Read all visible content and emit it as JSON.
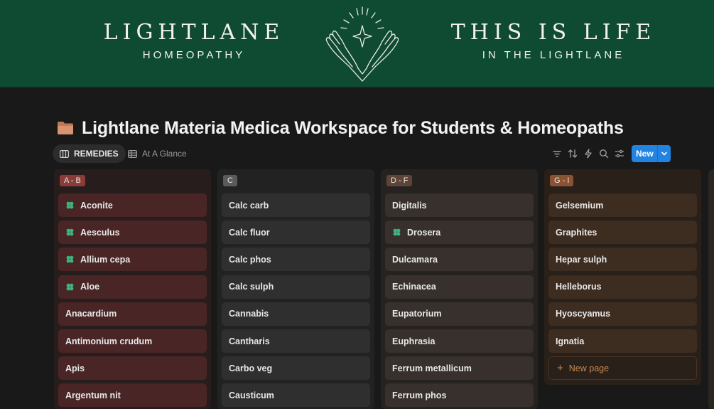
{
  "banner": {
    "left_main": "LIGHTLANE",
    "left_sub": "HOMEOPATHY",
    "right_main": "THIS IS LIFE",
    "right_sub": "IN THE LIGHTLANE",
    "background": "#0f4a32"
  },
  "page": {
    "icon": "folder-icon",
    "title": "Lightlane Materia Medica Workspace for Students & Homeopaths"
  },
  "views": {
    "tabs": [
      {
        "label": "REMEDIES",
        "icon": "board-icon",
        "active": true
      },
      {
        "label": "At A Glance",
        "icon": "table-icon",
        "active": false
      }
    ],
    "tools": [
      "filter-icon",
      "sort-icon",
      "automation-icon",
      "search-icon",
      "settings-icon"
    ],
    "new_label": "New",
    "accent": "#2383e2"
  },
  "columns": [
    {
      "label": "A - B",
      "badge_color": "#8c3c38",
      "card_color": "#4a2526",
      "bg_color": "#271d1d",
      "cards": [
        {
          "title": "Aconite",
          "icon": "clover"
        },
        {
          "title": "Aesculus",
          "icon": "clover"
        },
        {
          "title": "Allium cepa",
          "icon": "clover"
        },
        {
          "title": "Aloe",
          "icon": "clover"
        },
        {
          "title": "Anacardium",
          "icon": ""
        },
        {
          "title": "Antimonium crudum",
          "icon": ""
        },
        {
          "title": "Apis",
          "icon": ""
        },
        {
          "title": "Argentum nit",
          "icon": ""
        }
      ]
    },
    {
      "label": "C",
      "badge_color": "#5a5a5a",
      "card_color": "#2f2f2f",
      "bg_color": "#222222",
      "cards": [
        {
          "title": "Calc carb",
          "icon": ""
        },
        {
          "title": "Calc fluor",
          "icon": ""
        },
        {
          "title": "Calc phos",
          "icon": ""
        },
        {
          "title": "Calc sulph",
          "icon": ""
        },
        {
          "title": "Cannabis",
          "icon": ""
        },
        {
          "title": "Cantharis",
          "icon": ""
        },
        {
          "title": "Carbo veg",
          "icon": ""
        },
        {
          "title": "Causticum",
          "icon": ""
        }
      ]
    },
    {
      "label": "D - F",
      "badge_color": "#5e4436",
      "card_color": "#37302c",
      "bg_color": "#262220",
      "cards": [
        {
          "title": "Digitalis",
          "icon": ""
        },
        {
          "title": "Drosera",
          "icon": "clover"
        },
        {
          "title": "Dulcamara",
          "icon": ""
        },
        {
          "title": "Echinacea",
          "icon": ""
        },
        {
          "title": "Eupatorium",
          "icon": ""
        },
        {
          "title": "Euphrasia",
          "icon": ""
        },
        {
          "title": "Ferrum metallicum",
          "icon": ""
        },
        {
          "title": "Ferrum phos",
          "icon": ""
        }
      ]
    },
    {
      "label": "G - I",
      "badge_color": "#8a5230",
      "card_color": "#3d2c20",
      "bg_color": "#282019",
      "cards": [
        {
          "title": "Gelsemium",
          "icon": ""
        },
        {
          "title": "Graphites",
          "icon": ""
        },
        {
          "title": "Hepar sulph",
          "icon": ""
        },
        {
          "title": "Helleborus",
          "icon": ""
        },
        {
          "title": "Hyoscyamus",
          "icon": ""
        },
        {
          "title": "Ignatia",
          "icon": ""
        }
      ],
      "new_page_label": "New page"
    }
  ]
}
